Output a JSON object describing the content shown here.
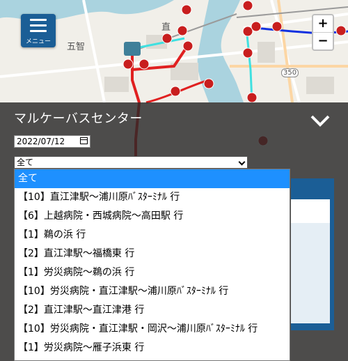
{
  "map": {
    "labels": [
      "五智",
      "直",
      "350"
    ],
    "zoom_in": "+",
    "zoom_out": "−",
    "menu_label": "メニュー"
  },
  "panel": {
    "title": "マルケーバスセンター",
    "date_value": "2022/07/12",
    "route_select_value": "全て"
  },
  "dropdown": {
    "options": [
      "全て",
      "【10】直江津駅～浦川原ﾊﾞｽﾀｰﾐﾅﾙ 行",
      "【6】上越病院・西城病院～高田駅 行",
      "【1】鵜の浜 行",
      "【2】直江津駅～福橋東 行",
      "【1】労災病院～鵜の浜 行",
      "【10】労災病院・直江津駅～浦川原ﾊﾞｽﾀｰﾐﾅﾙ 行",
      "【2】直江津駅～直江津港 行",
      "【10】労災病院・直江津駅・岡沢～浦川原ﾊﾞｽﾀｰﾐﾅﾙ 行",
      "【1】労災病院～雁子浜東 行"
    ]
  },
  "colors": {
    "accent": "#1b5e96",
    "selected_option": "#1e90ff",
    "route_red": "#e02020",
    "route_blue": "#1030e0",
    "route_cyan": "#40e0e0"
  }
}
